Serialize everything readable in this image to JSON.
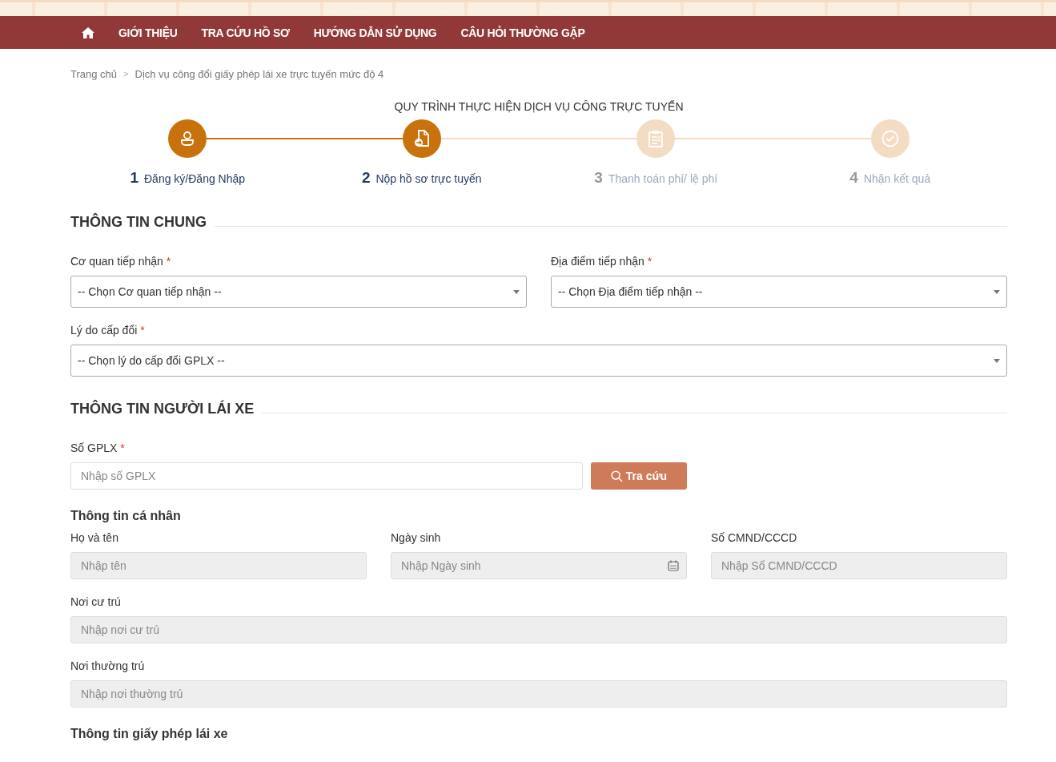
{
  "nav": {
    "items": [
      "GIỚI THIỆU",
      "TRA CỨU HỒ SƠ",
      "HƯỚNG DẪN SỬ DỤNG",
      "CÂU HỎI THƯỜNG GẶP"
    ]
  },
  "breadcrumb": {
    "items": [
      "Trang chủ",
      "Dịch vụ công đổi giấy phép lái xe trực tuyến mức độ 4"
    ],
    "separator": ">"
  },
  "process": {
    "title": "QUY TRÌNH THỰC HIỆN DỊCH VỤ CÔNG TRỰC TUYẾN",
    "steps": [
      {
        "number": "1",
        "label": "Đăng ký/Đăng Nhập",
        "kind": "user",
        "completed": true
      },
      {
        "number": "2",
        "label": "Nộp hồ sơ trực tuyến",
        "kind": "file",
        "completed": true
      },
      {
        "number": "3",
        "label": "Thanh toán phí/ lệ phí",
        "kind": "clipboard",
        "completed": false
      },
      {
        "number": "4",
        "label": "Nhận kết quả",
        "kind": "check",
        "completed": false
      }
    ]
  },
  "sections": [
    {
      "title": "THÔNG TIN CHUNG",
      "blocks": [
        {
          "kind": "fields",
          "fields": [
            {
              "kind": "select",
              "label": "Cơ quan tiếp nhận",
              "required_mark": "*",
              "value": "-- Chọn Cơ quan tiếp nhận --",
              "disabled": false
            },
            {
              "kind": "select",
              "label": "Địa điểm tiếp nhận",
              "required_mark": "*",
              "value": "-- Chọn Địa điểm tiếp nhận --",
              "disabled": false
            }
          ]
        },
        {
          "kind": "fields",
          "fields": [
            {
              "kind": "select",
              "label": "Lý do cấp đổi",
              "required_mark": "*",
              "value": "-- Chọn lý do cấp đổi GPLX --",
              "disabled": false
            }
          ]
        }
      ]
    },
    {
      "title": "THÔNG TIN NGƯỜI LÁI XE",
      "blocks": [
        {
          "kind": "fields",
          "fields": [
            {
              "kind": "search",
              "label": "Số GPLX",
              "required_mark": "*",
              "placeholder": "Nhập số GPLX",
              "button": "Tra cứu",
              "disabled": false
            }
          ]
        },
        {
          "kind": "heading",
          "text": "Thông tin cá nhân"
        },
        {
          "kind": "fields",
          "fields": [
            {
              "kind": "text",
              "label": "Họ và tên",
              "placeholder": "Nhập tên",
              "disabled": true
            },
            {
              "kind": "date",
              "label": "Ngày sinh",
              "placeholder": "Nhập Ngày sinh",
              "disabled": true
            },
            {
              "kind": "text",
              "label": "Số CMND/CCCD",
              "placeholder": "Nhập Số CMND/CCCD",
              "disabled": true
            }
          ]
        },
        {
          "kind": "fields",
          "fields": [
            {
              "kind": "text",
              "label": "Nơi cư trú",
              "placeholder": "Nhập nơi cư trú",
              "disabled": true
            }
          ]
        },
        {
          "kind": "fields",
          "fields": [
            {
              "kind": "text",
              "label": "Nơi thường trú",
              "placeholder": "Nhập nơi thường trú",
              "disabled": true
            }
          ]
        },
        {
          "kind": "heading",
          "text": "Thông tin giấy phép lái xe"
        }
      ]
    }
  ]
}
